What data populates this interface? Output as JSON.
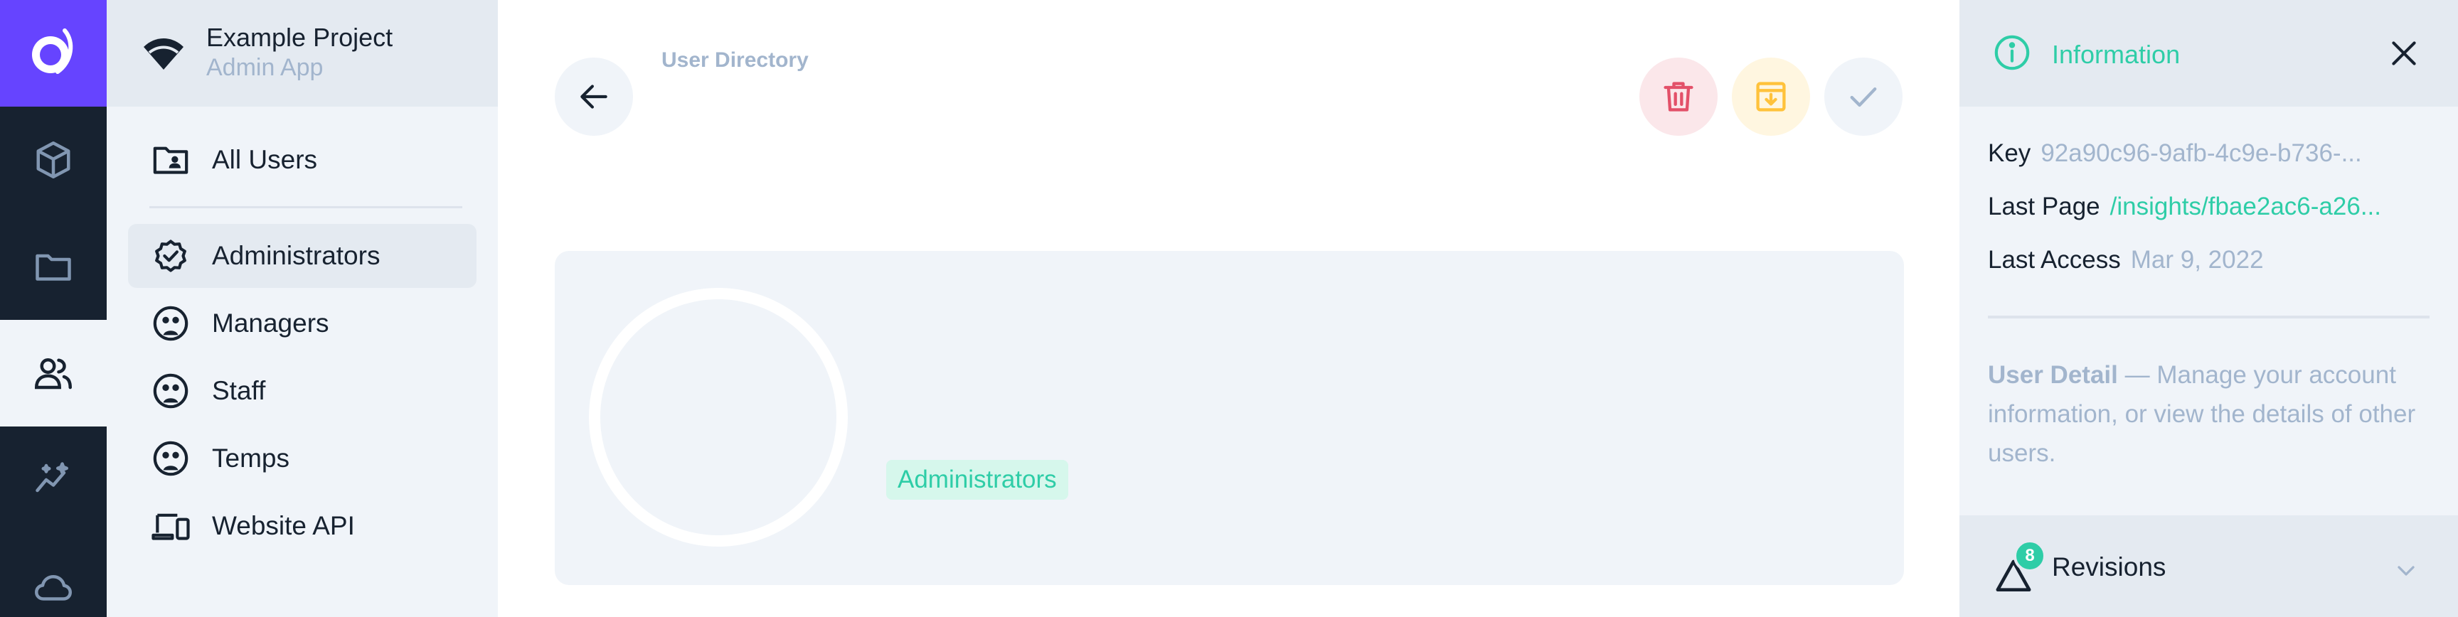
{
  "app": {
    "project_title": "Example Project",
    "project_subtitle": "Admin App"
  },
  "modules": [
    {
      "name": "content",
      "icon": "cube-icon"
    },
    {
      "name": "files",
      "icon": "folder-icon"
    },
    {
      "name": "users",
      "icon": "users-icon",
      "active": true
    },
    {
      "name": "insights",
      "icon": "insights-icon"
    },
    {
      "name": "cloud",
      "icon": "cloud-icon"
    }
  ],
  "nav": {
    "all_users": "All Users",
    "items": [
      {
        "label": "Administrators",
        "icon": "badge-check-icon",
        "active": true
      },
      {
        "label": "Managers",
        "icon": "face-icon"
      },
      {
        "label": "Staff",
        "icon": "face-icon"
      },
      {
        "label": "Temps",
        "icon": "face-icon"
      },
      {
        "label": "Website API",
        "icon": "devices-icon"
      }
    ]
  },
  "header": {
    "breadcrumb": "User Directory"
  },
  "user": {
    "role": "Administrators"
  },
  "sidebar": {
    "title": "Information",
    "key_label": "Key",
    "key_value": "92a90c96-9afb-4c9e-b736-...",
    "last_page_label": "Last Page",
    "last_page_value": "/insights/fbae2ac6-a26...",
    "last_access_label": "Last Access",
    "last_access_value": "Mar 9, 2022",
    "detail_title": "User Detail",
    "detail_text": " — Manage your account information, or view the details of other users.",
    "revisions_label": "Revisions",
    "revisions_count": "8"
  },
  "colors": {
    "accent": "#2ecda7",
    "brand": "#6644ff",
    "danger": "#e35169",
    "warning": "#ffc23b",
    "dark": "#172230"
  }
}
